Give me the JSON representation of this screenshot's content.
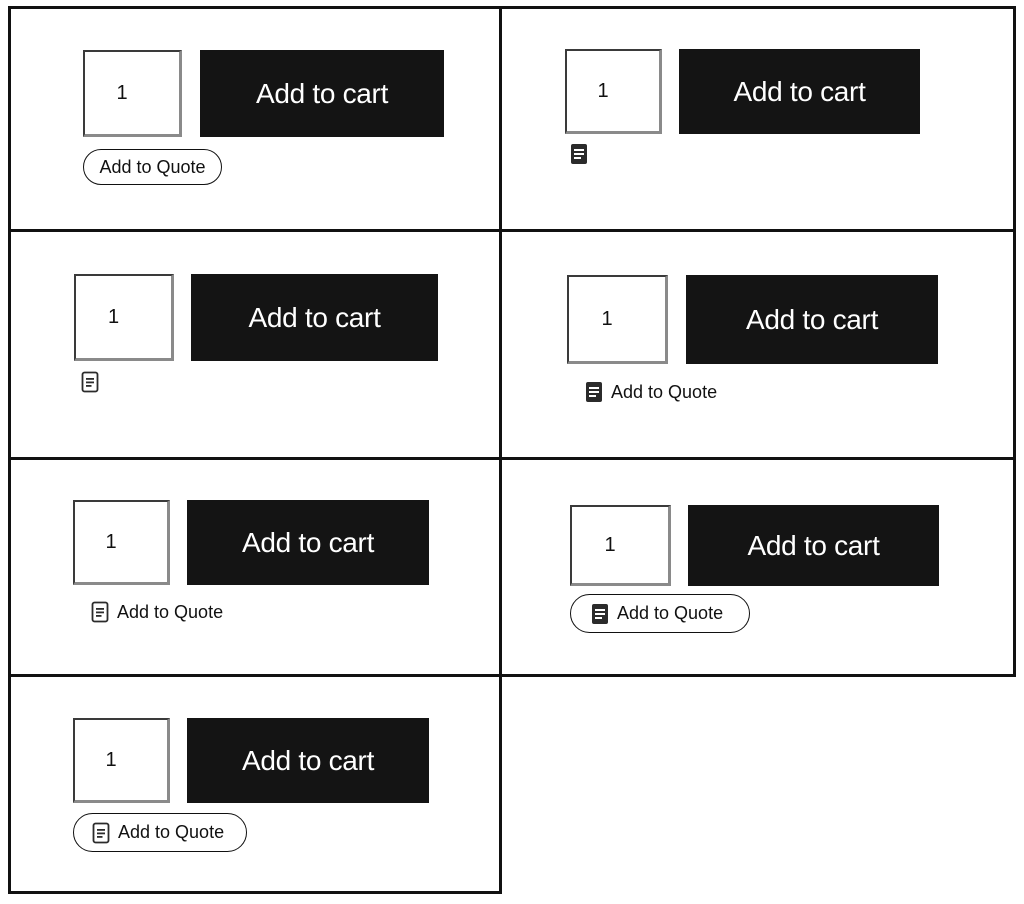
{
  "quantity_value": "1",
  "cart_label": "Add to cart",
  "quote_label": "Add to Quote",
  "variants": [
    {
      "quantity": "1",
      "cart_label": "Add to cart",
      "quote_style": "pill-text",
      "quote_label": "Add to Quote",
      "icon": null
    },
    {
      "quantity": "1",
      "cart_label": "Add to cart",
      "quote_style": "icon-only",
      "quote_label": "",
      "icon": "document-filled-icon"
    },
    {
      "quantity": "1",
      "cart_label": "Add to cart",
      "quote_style": "icon-only",
      "quote_label": "",
      "icon": "document-outline-icon"
    },
    {
      "quantity": "1",
      "cart_label": "Add to cart",
      "quote_style": "icon-text",
      "quote_label": "Add to Quote",
      "icon": "document-filled-icon"
    },
    {
      "quantity": "1",
      "cart_label": "Add to cart",
      "quote_style": "icon-text",
      "quote_label": "Add to Quote",
      "icon": "document-outline-icon"
    },
    {
      "quantity": "1",
      "cart_label": "Add to cart",
      "quote_style": "pill-icon-text",
      "quote_label": "Add to Quote",
      "icon": "document-filled-icon"
    },
    {
      "quantity": "1",
      "cart_label": "Add to cart",
      "quote_style": "pill-icon-text",
      "quote_label": "Add to Quote",
      "icon": "document-outline-icon"
    }
  ],
  "colors": {
    "cart_background": "#141414",
    "cart_text": "#ffffff",
    "border": "#111111"
  }
}
